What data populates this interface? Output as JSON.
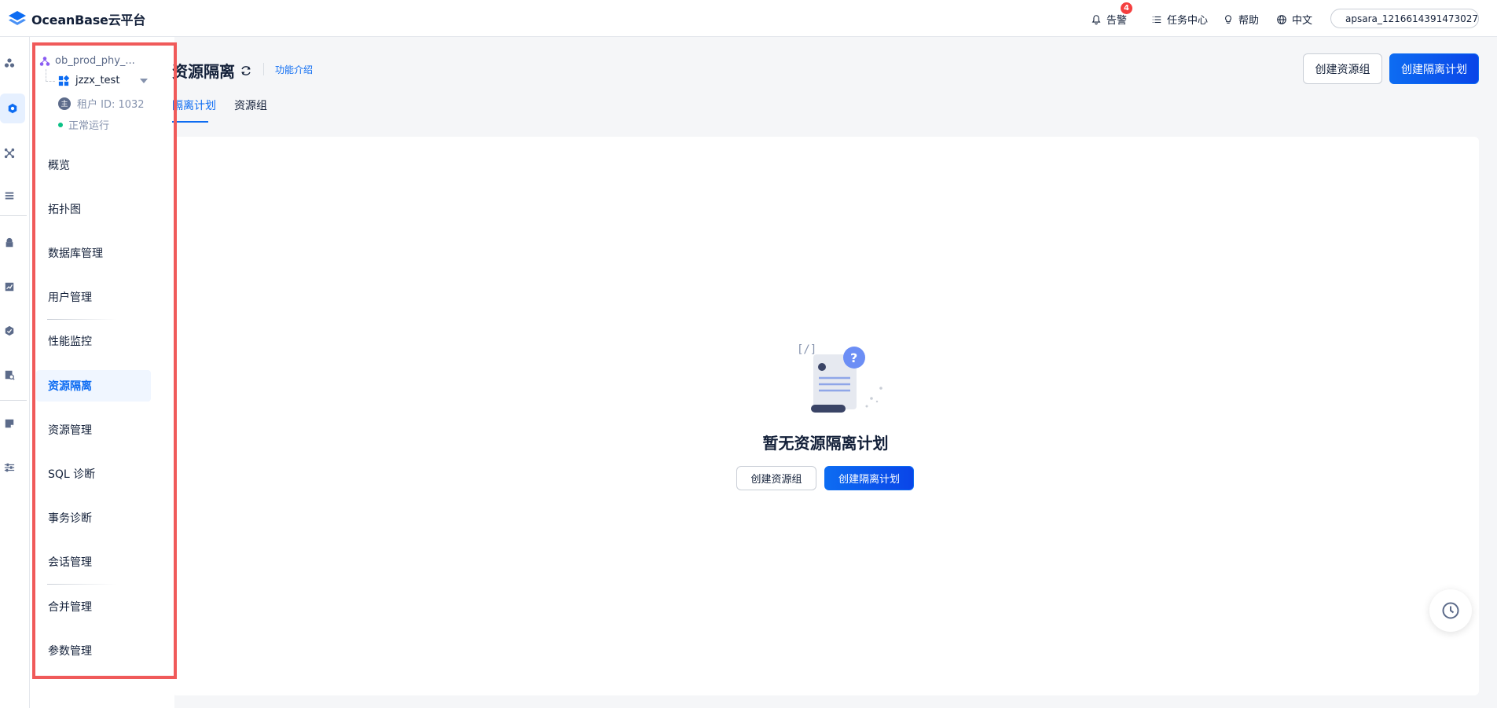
{
  "header": {
    "logo_text": "OceanBase云平台",
    "alarm_label": "告警",
    "alarm_count": "4",
    "task_center_label": "任务中心",
    "help_label": "帮助",
    "language_label": "中文",
    "user_name": "apsara_1216614391473027"
  },
  "sidebar": {
    "cluster_name": "ob_prod_phy_...",
    "tenant_name": "jzzx_test",
    "tenant_badge": "主",
    "tenant_id": "租户 ID: 1032",
    "status": "正常运行",
    "items": [
      {
        "label": "概览"
      },
      {
        "label": "拓扑图"
      },
      {
        "label": "数据库管理"
      },
      {
        "label": "用户管理"
      },
      {
        "label": "性能监控"
      },
      {
        "label": "资源隔离"
      },
      {
        "label": "资源管理"
      },
      {
        "label": "SQL 诊断"
      },
      {
        "label": "事务诊断"
      },
      {
        "label": "会话管理"
      },
      {
        "label": "合并管理"
      },
      {
        "label": "参数管理"
      }
    ]
  },
  "main": {
    "title": "资源隔离",
    "intro_link": "功能介绍",
    "tabs": [
      {
        "label": "隔离计划"
      },
      {
        "label": "资源组"
      }
    ],
    "create_group_button": "创建资源组",
    "create_plan_button": "创建隔离计划",
    "empty_text": "暂无资源隔离计划",
    "empty_create_group_button": "创建资源组",
    "empty_create_plan_button": "创建隔离计划"
  },
  "colors": {
    "primary": "#0d6cf2",
    "highlight_frame": "#f05a5a",
    "status_ok": "#0ac185"
  }
}
